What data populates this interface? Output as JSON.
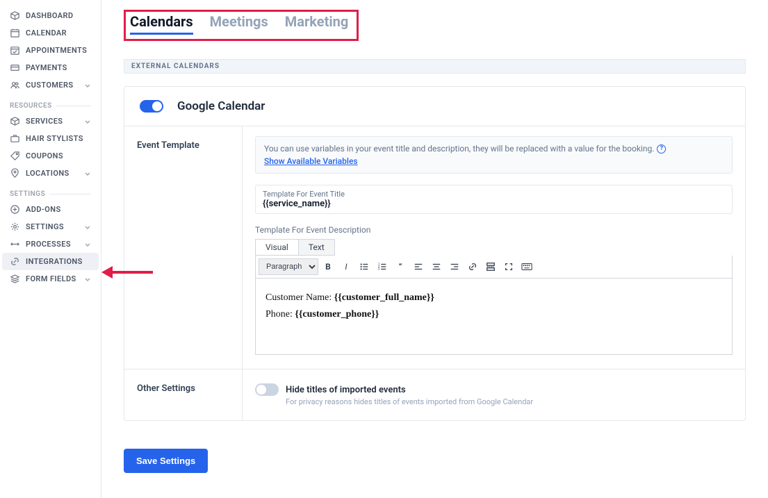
{
  "sidebar": {
    "main": [
      {
        "label": "DASHBOARD",
        "icon": "cube"
      },
      {
        "label": "CALENDAR",
        "icon": "calendar"
      },
      {
        "label": "APPOINTMENTS",
        "icon": "calendar-check"
      },
      {
        "label": "PAYMENTS",
        "icon": "card"
      },
      {
        "label": "CUSTOMERS",
        "icon": "users",
        "chev": true
      }
    ],
    "section_resources": "RESOURCES",
    "resources": [
      {
        "label": "SERVICES",
        "icon": "cube",
        "chev": true
      },
      {
        "label": "HAIR STYLISTS",
        "icon": "briefcase"
      },
      {
        "label": "COUPONS",
        "icon": "tag"
      },
      {
        "label": "LOCATIONS",
        "icon": "pin",
        "chev": true
      }
    ],
    "section_settings": "SETTINGS",
    "settings": [
      {
        "label": "ADD-ONS",
        "icon": "plus-circle"
      },
      {
        "label": "SETTINGS",
        "icon": "gear",
        "chev": true
      },
      {
        "label": "PROCESSES",
        "icon": "arrows",
        "chev": true
      },
      {
        "label": "INTEGRATIONS",
        "icon": "link",
        "active": true
      },
      {
        "label": "FORM FIELDS",
        "icon": "stack",
        "chev": true
      }
    ]
  },
  "tabs": [
    {
      "label": "Calendars",
      "active": true
    },
    {
      "label": "Meetings"
    },
    {
      "label": "Marketing"
    }
  ],
  "section_heading": "EXTERNAL CALENDARS",
  "card": {
    "toggle_on": true,
    "title": "Google Calendar",
    "event_template_label": "Event Template",
    "info_text": "You can use variables in your event title and description, they will be replaced with a value for the booking.",
    "info_link": "Show Available Variables",
    "title_field_label": "Template For Event Title",
    "title_field_value": "{{service_name}}",
    "desc_field_label": "Template For Event Description",
    "editor_tabs": {
      "visual": "Visual",
      "text": "Text"
    },
    "toolbar_paragraph": "Paragraph",
    "rte_line1_label": "Customer Name: ",
    "rte_line1_var": "{{customer_full_name}}",
    "rte_line2_label": "Phone: ",
    "rte_line2_var": "{{customer_phone}}",
    "other_settings_label": "Other Settings",
    "hide_titles_label": "Hide titles of imported events",
    "hide_titles_sub": "For privacy reasons hides titles of events imported from Google Calendar"
  },
  "save_button": "Save Settings"
}
